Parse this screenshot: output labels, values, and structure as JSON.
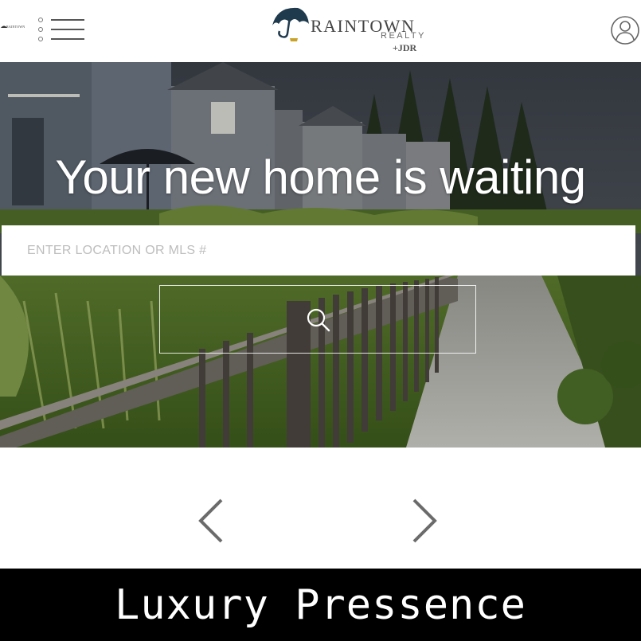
{
  "header": {
    "mini_logo_text": "RAINTOWN",
    "menu_icon": "menu-icon",
    "brand": {
      "name": "RAINTOWN",
      "subtitle": "REALTY",
      "mark": "+JDR",
      "icon": "umbrella-icon"
    },
    "account_icon": "user-icon"
  },
  "hero": {
    "title": "Your new home is waiting",
    "search_placeholder": "ENTER LOCATION OR MLS #",
    "search_value": "",
    "search_icon": "search-icon"
  },
  "carousel": {
    "prev_icon": "chevron-left-icon",
    "next_icon": "chevron-right-icon"
  },
  "caption": {
    "text": "Luxury Pressence"
  },
  "colors": {
    "header_bg": "#ffffff",
    "brand_text": "#444444",
    "arrow": "#6b6b6b",
    "caption_bg": "#000000",
    "caption_text": "#ffffff"
  }
}
